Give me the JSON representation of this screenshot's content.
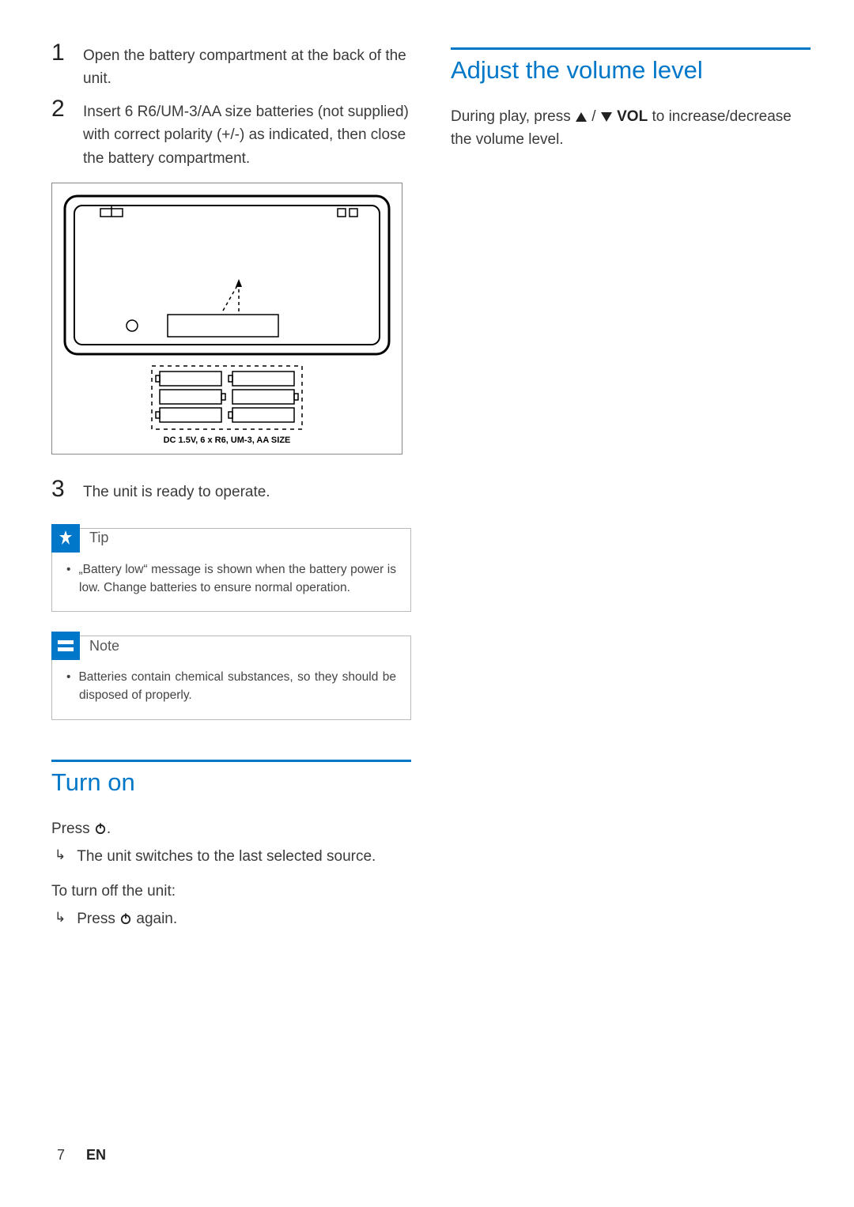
{
  "left": {
    "steps": [
      {
        "num": "1",
        "text": "Open the battery compartment at the back of the unit."
      },
      {
        "num": "2",
        "text": "Insert 6 R6/UM-3/AA size batteries (not supplied) with correct polarity (+/-) as indicated, then close the battery compartment."
      },
      {
        "num": "3",
        "text": "The unit is ready to operate."
      }
    ],
    "diagram_label": "DC 1.5V, 6 x R6, UM-3, AA SIZE",
    "tip": {
      "title": "Tip",
      "items": [
        "„Battery low“ message is shown when the battery power is low. Change batteries to ensure normal operation."
      ]
    },
    "note": {
      "title": "Note",
      "items": [
        "Batteries contain chemical substances, so they should be disposed of properly."
      ]
    },
    "turn_on": {
      "heading": "Turn on",
      "press_prefix": "Press ",
      "press_suffix": ".",
      "result1": "The unit switches to the last selected source.",
      "off_label": "To turn off the unit:",
      "result2_prefix": "Press ",
      "result2_suffix": " again."
    }
  },
  "right": {
    "heading": "Adjust the volume level",
    "body_prefix": "During play, press ",
    "body_mid": " / ",
    "vol_label": "VOL",
    "body_suffix": " to increase/decrease the volume level."
  },
  "footer": {
    "page": "7",
    "lang": "EN"
  }
}
